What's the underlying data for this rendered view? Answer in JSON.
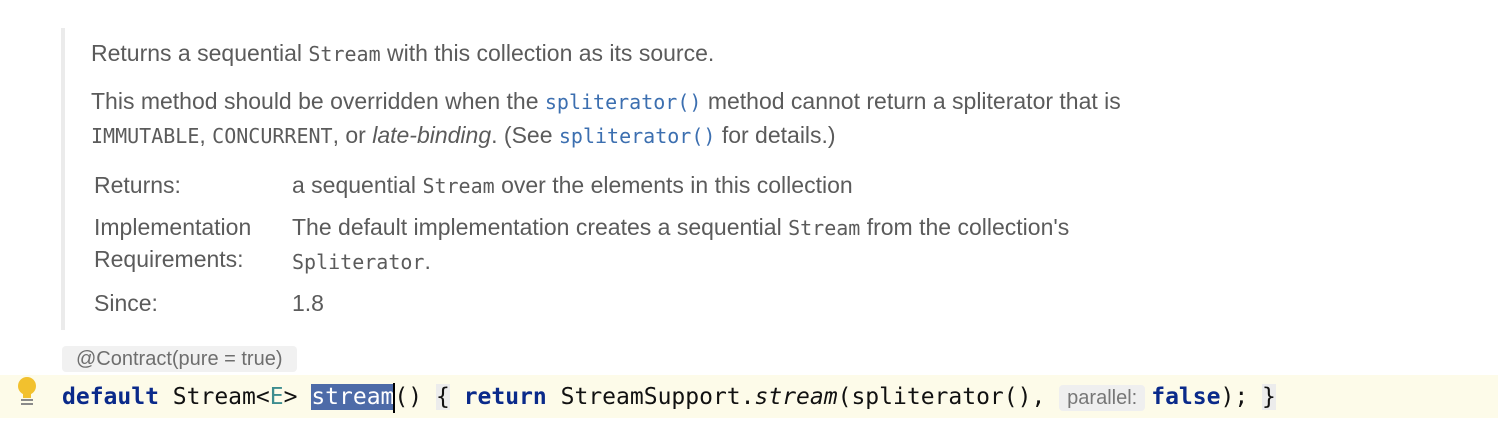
{
  "doc": {
    "summary": {
      "pre": "Returns a sequential ",
      "code": "Stream",
      "post": " with this collection as its source."
    },
    "para": {
      "line1_pre": "This method should be overridden when the ",
      "link1": "spliterator()",
      "line1_post": " method cannot return a spliterator that is",
      "code1": "IMMUTABLE",
      "sep1": ", ",
      "code2": "CONCURRENT",
      "sep2": ", or ",
      "em": "late-binding",
      "see_pre": ". (See ",
      "link2": "spliterator()",
      "see_post": " for details.)"
    },
    "tags": {
      "returns_label": "Returns:",
      "returns_pre": "a sequential ",
      "returns_code": "Stream",
      "returns_post": " over the elements in this collection",
      "impl_label_1": "Implementation",
      "impl_label_2": "Requirements:",
      "impl_pre": "The default implementation creates a sequential ",
      "impl_code": "Stream",
      "impl_post": " from the collection's",
      "impl_code2": "Spliterator",
      "impl_end": ".",
      "since_label": "Since:",
      "since_value": "1.8"
    }
  },
  "annotation": "@Contract(pure = true)",
  "code": {
    "kw_default": "default",
    "type_stream": "Stream<",
    "type_param": "E",
    "type_close": ">",
    "method": "stream",
    "parens": "()",
    "open_brace": "{",
    "kw_return": "return",
    "call_pre": "StreamSupport.",
    "call_method": "stream",
    "call_args": "(spliterator(), ",
    "hint": "parallel:",
    "kw_false": "false",
    "end": ");",
    "close_brace": "}"
  },
  "icons": {
    "intention": "lightbulb-icon"
  },
  "colors": {
    "keyword": "#0a2a8a",
    "link": "#3c6fb0",
    "selection": "#4d6ba8",
    "current_line": "#fdfbe9"
  }
}
